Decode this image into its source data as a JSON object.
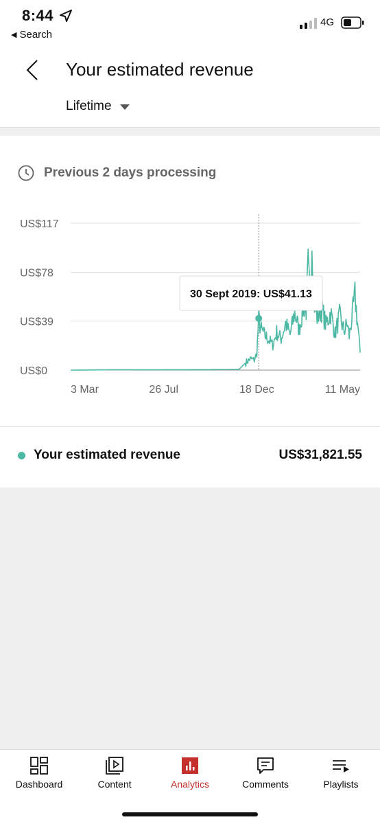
{
  "status_bar": {
    "time": "8:44",
    "back_app": "Search",
    "network": "4G"
  },
  "header": {
    "title": "Your estimated revenue",
    "period": "Lifetime"
  },
  "processing_note": "Previous 2 days processing",
  "tooltip": "30 Sept 2019: US$41.13",
  "legend": {
    "label": "Your estimated revenue",
    "value": "US$31,821.55",
    "color": "#4db8a4"
  },
  "chart_data": {
    "type": "line",
    "x_tick_labels": [
      "3 Mar",
      "26 Jul",
      "18 Dec",
      "11 May"
    ],
    "y_tick_labels": [
      "US$0",
      "US$39",
      "US$78",
      "US$117"
    ],
    "ylim": [
      0,
      117
    ],
    "grid": true,
    "series": [
      {
        "name": "Your estimated revenue",
        "color": "#4db8a4",
        "points": [
          [
            "2018-03-03",
            0
          ],
          [
            "2018-05-01",
            0.2
          ],
          [
            "2018-07-26",
            0.3
          ],
          [
            "2018-10-01",
            0.4
          ],
          [
            "2018-11-20",
            0.5
          ],
          [
            "2018-12-01",
            6
          ],
          [
            "2018-12-08",
            9
          ],
          [
            "2018-12-14",
            8
          ],
          [
            "2018-12-18",
            13
          ],
          [
            "2018-12-21",
            41.13
          ],
          [
            "2018-12-24",
            33
          ],
          [
            "2018-12-30",
            28
          ],
          [
            "2019-01-06",
            24
          ],
          [
            "2019-01-12",
            20
          ],
          [
            "2019-01-18",
            30
          ],
          [
            "2019-01-25",
            25
          ],
          [
            "2019-02-01",
            37
          ],
          [
            "2019-02-08",
            28
          ],
          [
            "2019-02-15",
            46
          ],
          [
            "2019-02-22",
            32
          ],
          [
            "2019-03-01",
            52
          ],
          [
            "2019-03-05",
            48
          ],
          [
            "2019-03-08",
            82
          ],
          [
            "2019-03-11",
            56
          ],
          [
            "2019-03-14",
            107
          ],
          [
            "2019-03-17",
            55
          ],
          [
            "2019-03-22",
            42
          ],
          [
            "2019-03-29",
            49
          ],
          [
            "2019-04-05",
            36
          ],
          [
            "2019-04-12",
            46
          ],
          [
            "2019-04-19",
            29
          ],
          [
            "2019-04-26",
            43
          ],
          [
            "2019-05-03",
            31
          ],
          [
            "2019-05-08",
            37
          ],
          [
            "2019-05-11",
            27
          ],
          [
            "2019-05-16",
            44
          ],
          [
            "2019-05-20",
            59
          ],
          [
            "2019-05-24",
            38
          ],
          [
            "2019-05-28",
            14
          ]
        ]
      }
    ]
  },
  "bottom_nav": [
    {
      "label": "Dashboard",
      "icon": "dashboard-icon"
    },
    {
      "label": "Content",
      "icon": "content-icon"
    },
    {
      "label": "Analytics",
      "icon": "analytics-icon",
      "active": true
    },
    {
      "label": "Comments",
      "icon": "comments-icon"
    },
    {
      "label": "Playlists",
      "icon": "playlists-icon"
    }
  ],
  "colors": {
    "accent": "#c4302b",
    "chart_line": "#4db8a4"
  }
}
